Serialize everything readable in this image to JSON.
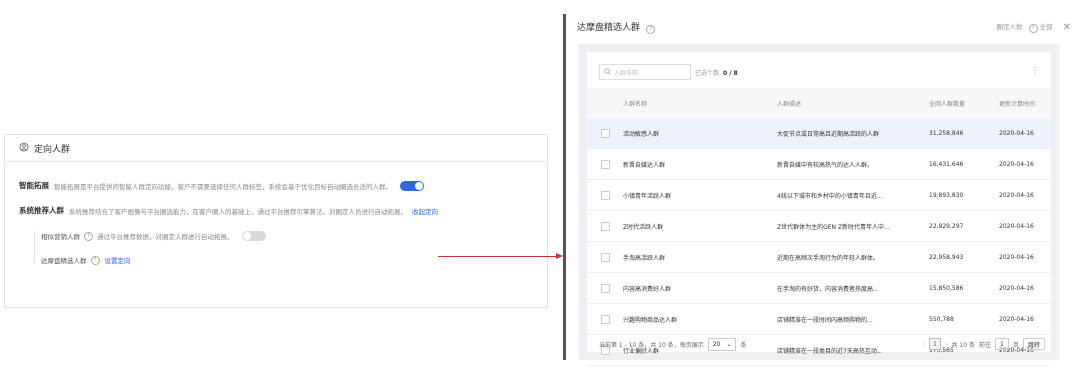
{
  "left": {
    "title": "定向人群",
    "smart_expand": {
      "label": "智能拓展",
      "desc": "智能拓展是平台提供的智能人群定向功能，客户不需要选择任何人群标签，系统会基于优化目标自动圈选合适的人群。",
      "enabled": true
    },
    "system_recommend": {
      "label": "系统推荐人群",
      "desc": "系统推荐结合了客户画像与平台圈选能力，在客户圈人的基础上，通过平台推荐引擎算法，对圈定人员进行自动拓展。",
      "link": "收起定向"
    },
    "lookalike": {
      "label": "相似营销人群",
      "desc": "通过平台推荐数据，对圈定人群进行自动拓展。",
      "enabled": false
    },
    "reach": {
      "label": "达摩盘精选人群",
      "link": "设置定向"
    }
  },
  "panel": {
    "title": "达摩盘精选人群",
    "right_label": "圈定人数",
    "clear_label": "全部",
    "search_placeholder": "人群名称",
    "selected_label": "已选个数:",
    "selected_value": "0 / 8",
    "columns": [
      "人群名称",
      "人群描述",
      "全网人群数量",
      "更新计算时间"
    ],
    "rows": [
      {
        "name": "活动敏感人群",
        "desc": "大促节点或日常高且近期高活跃的人群",
        "count": "31,258,846",
        "date": "2020-04-16"
      },
      {
        "name": "新晋自媒达人群",
        "desc": "新晋自媒中有较高热气的达人人群。",
        "count": "16,431,646",
        "date": "2020-04-16"
      },
      {
        "name": "小镇青年活跃人群",
        "desc": "4线以下城市和乡村中的小镇青年且近...",
        "count": "19,893,830",
        "date": "2020-04-16"
      },
      {
        "name": "Z时代活跃人群",
        "desc": "Z世代群体为主的GEN Z新时代青年人中...",
        "count": "22,929,297",
        "date": "2020-04-16"
      },
      {
        "name": "手淘高活跃人群",
        "desc": "近期在高频次手淘行为的年轻人群体。",
        "count": "22,958,943",
        "date": "2020-04-16"
      },
      {
        "name": "内容高消费好人群",
        "desc": "在手淘的有好货、内容消费者热度高...",
        "count": "15,850,586",
        "date": "2020-04-16"
      },
      {
        "name": "兴趣购物商品达人群",
        "desc": "店铺精准在一段时间内高频购物的...",
        "count": "550,788",
        "date": "2020-04-16"
      },
      {
        "name": "行业偏好人群",
        "desc": "店铺精准在一段类目的近7天高热互动...",
        "count": "175,565",
        "date": "2020-04-16"
      }
    ],
    "footer": {
      "summary": "当前第 1 - 10 条，共 10 条，每页展示",
      "page_size": "20",
      "unit": "条",
      "current_page": "1",
      "total": "共 10 条",
      "goto_label": "前往",
      "goto_value": "1",
      "page_unit": "页",
      "jump_button": "跳转"
    }
  },
  "colors": {
    "accent": "#2f66e8",
    "arrow": "#cc3333",
    "toggle_off": "#d9d9d9"
  }
}
